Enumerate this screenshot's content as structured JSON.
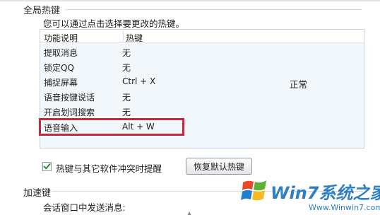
{
  "global_hotkeys": {
    "title": "全局热键",
    "hint": "您可以通过点击选择要更改的热键。",
    "columns": [
      "功能说明",
      "热键"
    ],
    "rows": [
      {
        "function": "提取消息",
        "hotkey": "无"
      },
      {
        "function": "锁定QQ",
        "hotkey": "无"
      },
      {
        "function": "捕捉屏幕",
        "hotkey": "Ctrl + X"
      },
      {
        "function": "语音按键说话",
        "hotkey": "无"
      },
      {
        "function": "开启划词搜索",
        "hotkey": "无"
      },
      {
        "function": "语音输入",
        "hotkey": "Alt + W"
      }
    ],
    "status": "正常",
    "highlighted_row": 5,
    "highlight_color": "#c8283a",
    "conflict_checkbox": {
      "checked": true,
      "label": "热键与其它软件冲突时提醒"
    },
    "restore_button": "恢复默认热键"
  },
  "accelerator": {
    "title": "加速键",
    "send_label": "会话窗口中发送消息:"
  },
  "watermark": {
    "brand": "Win7系统之家",
    "domain": "Www.Winwin7.com",
    "logo_icon": "windows-flag-icon"
  }
}
